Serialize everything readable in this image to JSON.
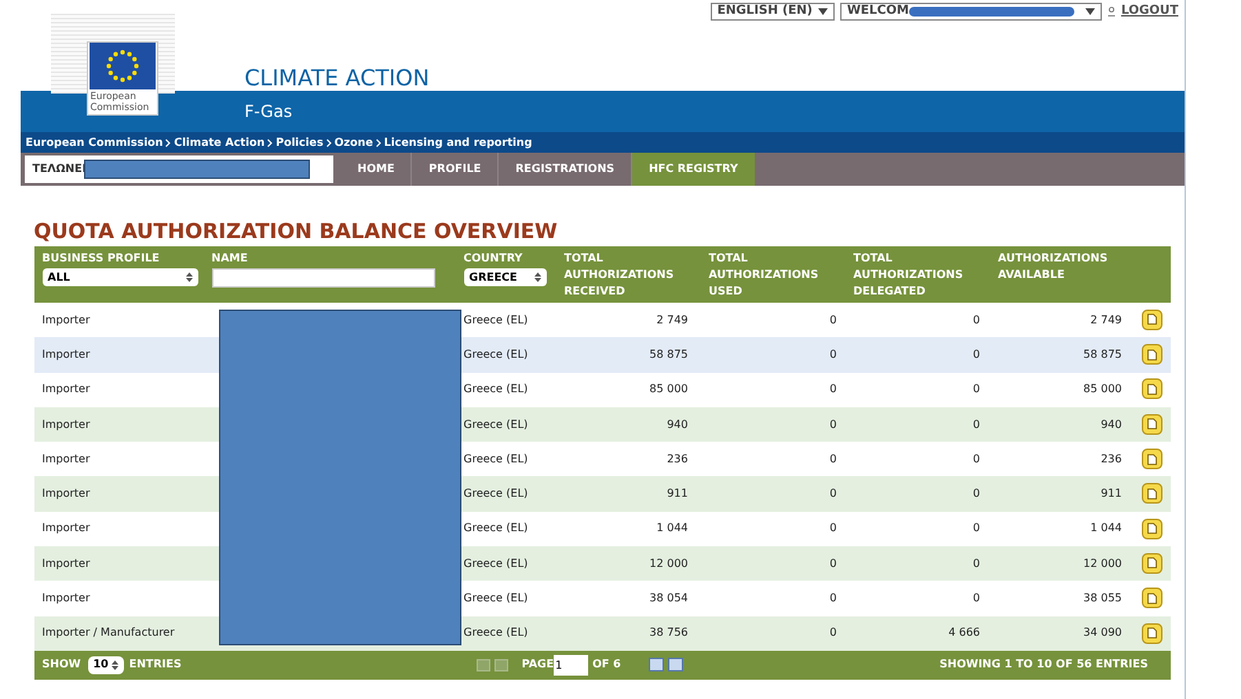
{
  "top_bar": {
    "language": "ENGLISH (EN)",
    "welcome": "WELCOM",
    "logout": "LOGOUT"
  },
  "logo": {
    "text": "European Commission"
  },
  "site": {
    "title": "CLIMATE ACTION",
    "subtitle": "F-Gas"
  },
  "breadcrumb": [
    "European Commission",
    "Climate Action",
    "Policies",
    "Ozone",
    "Licensing and reporting"
  ],
  "user_label": "ΤΕΛΩΝΕΙ",
  "nav": [
    {
      "label": "HOME",
      "selected": false
    },
    {
      "label": "PROFILE",
      "selected": false
    },
    {
      "label": "REGISTRATIONS",
      "selected": false
    },
    {
      "label": "HFC REGISTRY",
      "selected": true
    }
  ],
  "page_title": "QUOTA AUTHORIZATION BALANCE OVERVIEW",
  "table": {
    "columns": [
      "BUSINESS PROFILE",
      "NAME",
      "COUNTRY",
      "TOTAL AUTHORIZATIONS RECEIVED",
      "TOTAL AUTHORIZATIONS USED",
      "TOTAL AUTHORIZATIONS DELEGATED",
      "AUTHORIZATIONS AVAILABLE"
    ],
    "filters": {
      "business_profile": "ALL",
      "country": "GREECE"
    },
    "rows": [
      {
        "profile": "Importer",
        "country": "Greece (EL)",
        "received": "2 749",
        "used": "0",
        "delegated": "0",
        "available": "2 749",
        "selected": false
      },
      {
        "profile": "Importer",
        "country": "Greece (EL)",
        "received": "58 875",
        "used": "0",
        "delegated": "0",
        "available": "58 875",
        "selected": true
      },
      {
        "profile": "Importer",
        "country": "Greece (EL)",
        "received": "85 000",
        "used": "0",
        "delegated": "0",
        "available": "85 000",
        "selected": false
      },
      {
        "profile": "Importer",
        "country": "Greece (EL)",
        "received": "940",
        "used": "0",
        "delegated": "0",
        "available": "940",
        "selected": false
      },
      {
        "profile": "Importer",
        "country": "Greece (EL)",
        "received": "236",
        "used": "0",
        "delegated": "0",
        "available": "236",
        "selected": false
      },
      {
        "profile": "Importer",
        "country": "Greece (EL)",
        "received": "911",
        "used": "0",
        "delegated": "0",
        "available": "911",
        "selected": false
      },
      {
        "profile": "Importer",
        "country": "Greece (EL)",
        "received": "1 044",
        "used": "0",
        "delegated": "0",
        "available": "1 044",
        "selected": false
      },
      {
        "profile": "Importer",
        "country": "Greece (EL)",
        "received": "12 000",
        "used": "0",
        "delegated": "0",
        "available": "12 000",
        "selected": false
      },
      {
        "profile": "Importer",
        "country": "Greece (EL)",
        "received": "38 054",
        "used": "0",
        "delegated": "0",
        "available": "38 055",
        "selected": false
      },
      {
        "profile": "Importer / Manufacturer",
        "country": "Greece (EL)",
        "received": "38 756",
        "used": "0",
        "delegated": "4 666",
        "available": "34 090",
        "selected": false
      }
    ]
  },
  "footer": {
    "show": "SHOW",
    "page_size": "10",
    "entries": "ENTRIES",
    "page": "PAGE",
    "page_value": "1",
    "of": "OF 6",
    "summary": "SHOWING 1 TO 10 OF 56 ENTRIES"
  }
}
